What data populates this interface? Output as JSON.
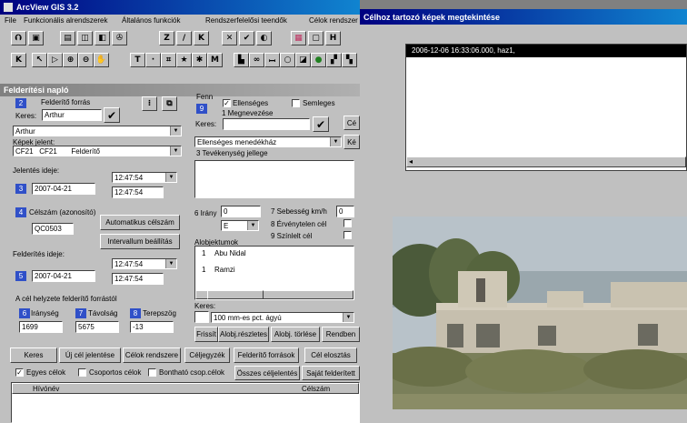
{
  "app": {
    "title": "ArcView GIS 3.2"
  },
  "menu": [
    "File",
    "Funkcionális alrendszerek",
    "Általános funkciók",
    "Rendszerfelelősi teendők",
    "Célok rendszer"
  ],
  "toolbar1": [
    "Z",
    "/",
    "K",
    "H"
  ],
  "toolbar2": [
    "K",
    "T",
    "M"
  ],
  "panel": {
    "title": "Felderítési napló",
    "s2": {
      "num": "2",
      "label": "Felderítő forrás",
      "keres_label": "Keres:",
      "keres_value": "Arthur",
      "select_value": "Arthur",
      "kepek_label": "Képek jelent:",
      "codes": [
        "CF21",
        "CF21",
        "Felderítő"
      ]
    },
    "s3": {
      "label": "Jelentés ideje:",
      "num": "3",
      "date": "2007-04-21",
      "time1": "12:47:54",
      "time2": "12:47:54"
    },
    "s4": {
      "num": "4",
      "label": "Célszám (azonosító)",
      "value": "QC0503",
      "btn_auto": "Automatikus célszám",
      "btn_interval": "Intervallum beállítás"
    },
    "s5": {
      "label": "Felderítés ideje:",
      "num": "5",
      "date": "2007-04-21",
      "time1": "12:47:54",
      "time2": "12:47:54"
    },
    "pos": {
      "label": "A cél helyzete felderítő forrástól",
      "n6": "6",
      "l6": "Iránység",
      "n7": "7",
      "l7": "Távolság",
      "n8": "8",
      "l8": "Terepszög",
      "v6": "1699",
      "v7": "5675",
      "v8": "-13"
    }
  },
  "right": {
    "fe_label": "Fenn",
    "num9": "9",
    "ellenseges": "Ellenséges",
    "semleges": "Semleges",
    "megnevezese": "1  Megnevezése",
    "keres": "Keres:",
    "btn_ce": "Cé",
    "btn_ke": "Ké",
    "select_value": "Ellenséges menedékház",
    "tevekenyseg": "3  Tevékenység jellege",
    "irany_label": "6  Irány",
    "irany_value": "0",
    "irany_dd": "E",
    "seb_label": "7  Sebesség km/h",
    "seb_value": "0",
    "ervenytelen": "8  Érvénytelen cél",
    "szinlelt": "9  Színlelt cél",
    "alobj_label": "Alobjektumok",
    "alobj": [
      {
        "n": "1",
        "name": "Abu Nidal"
      },
      {
        "n": "1",
        "name": "Ramzi"
      }
    ],
    "keres2": "Keres:",
    "keres2_select": "100 mm-es pct. ágyú",
    "btn_frissit": "Frissít",
    "btn_alobj_reszletes": "Alobj.részletes",
    "btn_alobj_torlese": "Alobj. törlése",
    "btn_rendben": "Rendben"
  },
  "bottom": {
    "buttons": [
      "Keres",
      "Új cél jelentése",
      "Célok rendszere",
      "Céljegyzék",
      "Felderítő források",
      "Cél elosztás"
    ],
    "chk_egyes": "Egyes célok",
    "chk_csoportos": "Csoportos célok",
    "chk_bonthato": "Bontható csop.célok",
    "btn_osszes": "Összes céljelentés",
    "btn_sajat": "Saját felderített",
    "col_hivonev": "Hívónév",
    "col_celszam": "Célszám"
  },
  "viewer": {
    "title": "Célhoz tartozó képek megtekintése",
    "list_item": "2006-12-06 16:33:06.000,   haz1,"
  }
}
